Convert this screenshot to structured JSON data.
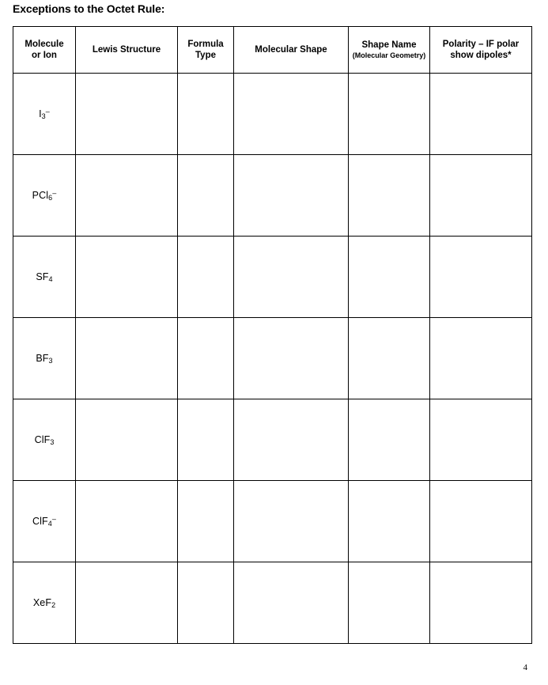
{
  "document": {
    "title": "Exceptions to the Octet Rule:",
    "page_number": "4"
  },
  "table": {
    "headers": [
      {
        "label": "Molecule or Ion",
        "line1": "Molecule",
        "line2": "or Ion",
        "sub": ""
      },
      {
        "label": "Lewis Structure",
        "line1": "Lewis Structure",
        "line2": "",
        "sub": ""
      },
      {
        "label": "Formula Type",
        "line1": "Formula",
        "line2": "Type",
        "sub": ""
      },
      {
        "label": "Molecular Shape",
        "line1": "Molecular Shape",
        "line2": "",
        "sub": ""
      },
      {
        "label": "Shape Name (Molecular Geometry)",
        "line1": "Shape Name",
        "line2": "",
        "sub": "(Molecular Geometry)"
      },
      {
        "label": "Polarity – IF polar show dipoles*",
        "line1": "Polarity – IF polar",
        "line2": "show dipoles*",
        "sub": ""
      }
    ],
    "rows": [
      {
        "molecule": {
          "base1": "I",
          "sub1": "3",
          "sup1": "–",
          "base2": ""
        },
        "lewis_structure": "",
        "formula_type": "",
        "molecular_shape": "",
        "shape_name": "",
        "polarity": ""
      },
      {
        "molecule": {
          "base1": "PCl",
          "sub1": "6",
          "sup1": "–",
          "base2": ""
        },
        "lewis_structure": "",
        "formula_type": "",
        "molecular_shape": "",
        "shape_name": "",
        "polarity": ""
      },
      {
        "molecule": {
          "base1": "SF",
          "sub1": "4",
          "sup1": "",
          "base2": ""
        },
        "lewis_structure": "",
        "formula_type": "",
        "molecular_shape": "",
        "shape_name": "",
        "polarity": ""
      },
      {
        "molecule": {
          "base1": "BF",
          "sub1": "3",
          "sup1": "",
          "base2": ""
        },
        "lewis_structure": "",
        "formula_type": "",
        "molecular_shape": "",
        "shape_name": "",
        "polarity": ""
      },
      {
        "molecule": {
          "base1": "ClF",
          "sub1": "3",
          "sup1": "",
          "base2": ""
        },
        "lewis_structure": "",
        "formula_type": "",
        "molecular_shape": "",
        "shape_name": "",
        "polarity": ""
      },
      {
        "molecule": {
          "base1": "ClF",
          "sub1": "4",
          "sup1": "–",
          "base2": ""
        },
        "lewis_structure": "",
        "formula_type": "",
        "molecular_shape": "",
        "shape_name": "",
        "polarity": ""
      },
      {
        "molecule": {
          "base1": "XeF",
          "sub1": "2",
          "sup1": "",
          "base2": ""
        },
        "lewis_structure": "",
        "formula_type": "",
        "molecular_shape": "",
        "shape_name": "",
        "polarity": ""
      }
    ]
  }
}
